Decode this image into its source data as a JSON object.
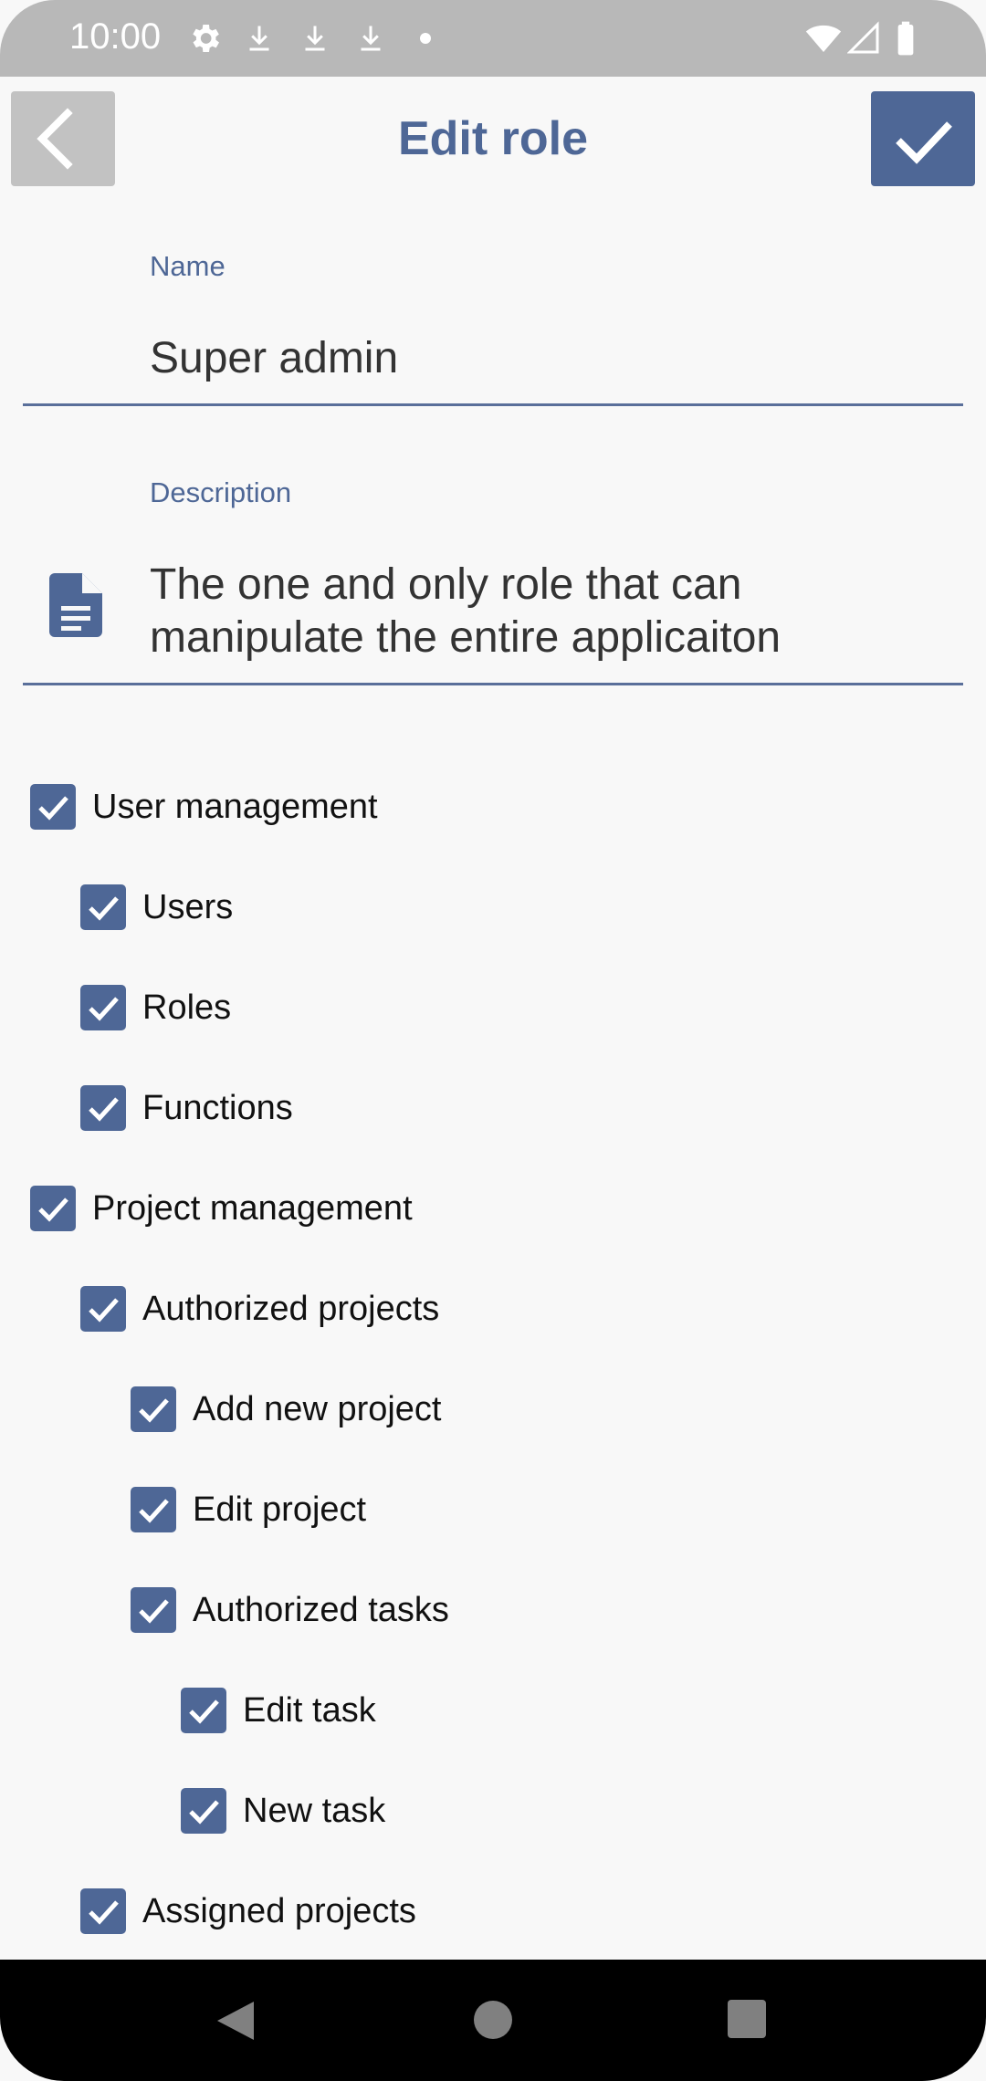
{
  "status_bar": {
    "time": "10:00",
    "icons": [
      "gear-icon",
      "download-icon",
      "download-icon",
      "download-icon",
      "dot-icon",
      "wifi-icon",
      "signal-icon",
      "battery-icon"
    ]
  },
  "app_bar": {
    "title": "Edit role",
    "back_icon": "chevron-left-icon",
    "save_icon": "checkmark-icon"
  },
  "form": {
    "name": {
      "label": "Name",
      "value": "Super admin"
    },
    "description": {
      "label": "Description",
      "line1": "The one and only role that can",
      "line2": "manipulate the entire applicaiton",
      "icon": "document-icon"
    }
  },
  "permissions": [
    {
      "label": "User management",
      "checked": true,
      "level": 0
    },
    {
      "label": "Users",
      "checked": true,
      "level": 1
    },
    {
      "label": "Roles",
      "checked": true,
      "level": 1
    },
    {
      "label": "Functions",
      "checked": true,
      "level": 1
    },
    {
      "label": "Project management",
      "checked": true,
      "level": 0
    },
    {
      "label": "Authorized projects",
      "checked": true,
      "level": 1
    },
    {
      "label": "Add new project",
      "checked": true,
      "level": 2
    },
    {
      "label": "Edit project",
      "checked": true,
      "level": 2
    },
    {
      "label": "Authorized tasks",
      "checked": true,
      "level": 2
    },
    {
      "label": "Edit task",
      "checked": true,
      "level": 3
    },
    {
      "label": "New task",
      "checked": true,
      "level": 3
    },
    {
      "label": "Assigned projects",
      "checked": true,
      "level": 1
    }
  ],
  "colors": {
    "accent": "#4e6796",
    "back_button": "#c2c2c2",
    "status_bar": "#b8b8b8"
  }
}
